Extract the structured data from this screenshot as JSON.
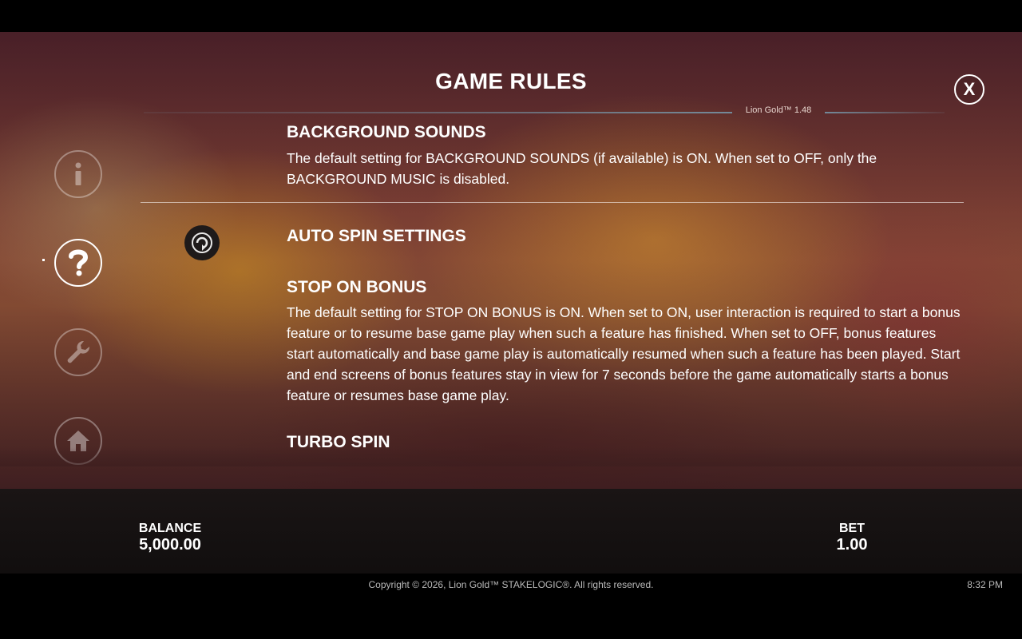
{
  "header": {
    "title": "GAME RULES",
    "version": "Lion Gold™ 1.48",
    "close_label": "X"
  },
  "sidebar": {
    "items": [
      {
        "name": "info",
        "icon": "info-icon",
        "active": false
      },
      {
        "name": "help",
        "icon": "question-icon",
        "active": true
      },
      {
        "name": "settings",
        "icon": "wrench-icon",
        "active": false
      },
      {
        "name": "home",
        "icon": "home-icon",
        "active": false
      }
    ]
  },
  "rules": {
    "background_sounds": {
      "heading": "BACKGROUND SOUNDS",
      "text": "The default setting for BACKGROUND SOUNDS (if available) is ON. When set to OFF, only the BACKGROUND MUSIC is disabled."
    },
    "auto_spin": {
      "heading": "AUTO SPIN SETTINGS",
      "icon": "auto-spin-icon"
    },
    "stop_on_bonus": {
      "heading": "STOP ON BONUS",
      "text": "The default setting for STOP ON BONUS is ON. When set to ON, user interaction is required to start a bonus feature or to resume base game play when such a feature has finished. When set to OFF, bonus features start automatically and base game play is automatically resumed when such a feature has been played. Start and end screens of bonus features stay in view for 7 seconds before the game automatically starts a bonus feature or resumes base game play."
    },
    "turbo_spin": {
      "heading": "TURBO SPIN"
    }
  },
  "status": {
    "balance_label": "BALANCE",
    "balance_value": "5,000.00",
    "bet_label": "BET",
    "bet_value": "1.00"
  },
  "footer": {
    "copyright": "Copyright © 2026, Lion Gold™ STAKELOGIC®. All rights reserved.",
    "time": "8:32 PM"
  },
  "colors": {
    "background": "#000000",
    "text": "#ffffff",
    "accent_line": "#78a0b4"
  }
}
